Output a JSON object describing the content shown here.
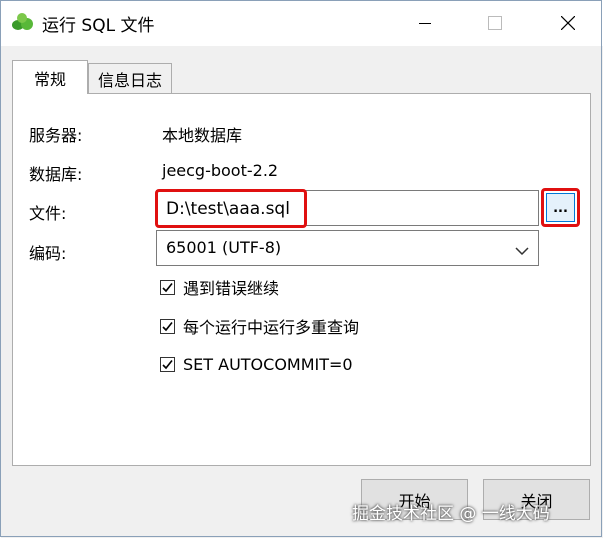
{
  "window": {
    "title": "运行 SQL 文件",
    "controls": [
      "minimize-icon",
      "maximize-icon",
      "close-icon"
    ]
  },
  "tabs": [
    {
      "label": "常规",
      "active": true
    },
    {
      "label": "信息日志",
      "active": false
    }
  ],
  "form": {
    "server_label": "服务器:",
    "server_value": "本地数据库",
    "database_label": "数据库:",
    "database_value": "jeecg-boot-2.2",
    "file_label": "文件:",
    "file_value": "D:\\test\\aaa.sql",
    "browse_label": "...",
    "encoding_label": "编码:",
    "encoding_value": "65001 (UTF-8)"
  },
  "options": [
    {
      "label": "遇到错误继续",
      "checked": true
    },
    {
      "label": "每个运行中运行多重查询",
      "checked": true
    },
    {
      "label": "SET AUTOCOMMIT=0",
      "checked": true
    }
  ],
  "buttons": {
    "start": "开始",
    "close": "关闭"
  },
  "watermark": "掘金技术社区 @ 一线大码",
  "colors": {
    "highlight": "#e01010",
    "accent": "#0078d7",
    "panel_bg": "#f0f0f0"
  }
}
